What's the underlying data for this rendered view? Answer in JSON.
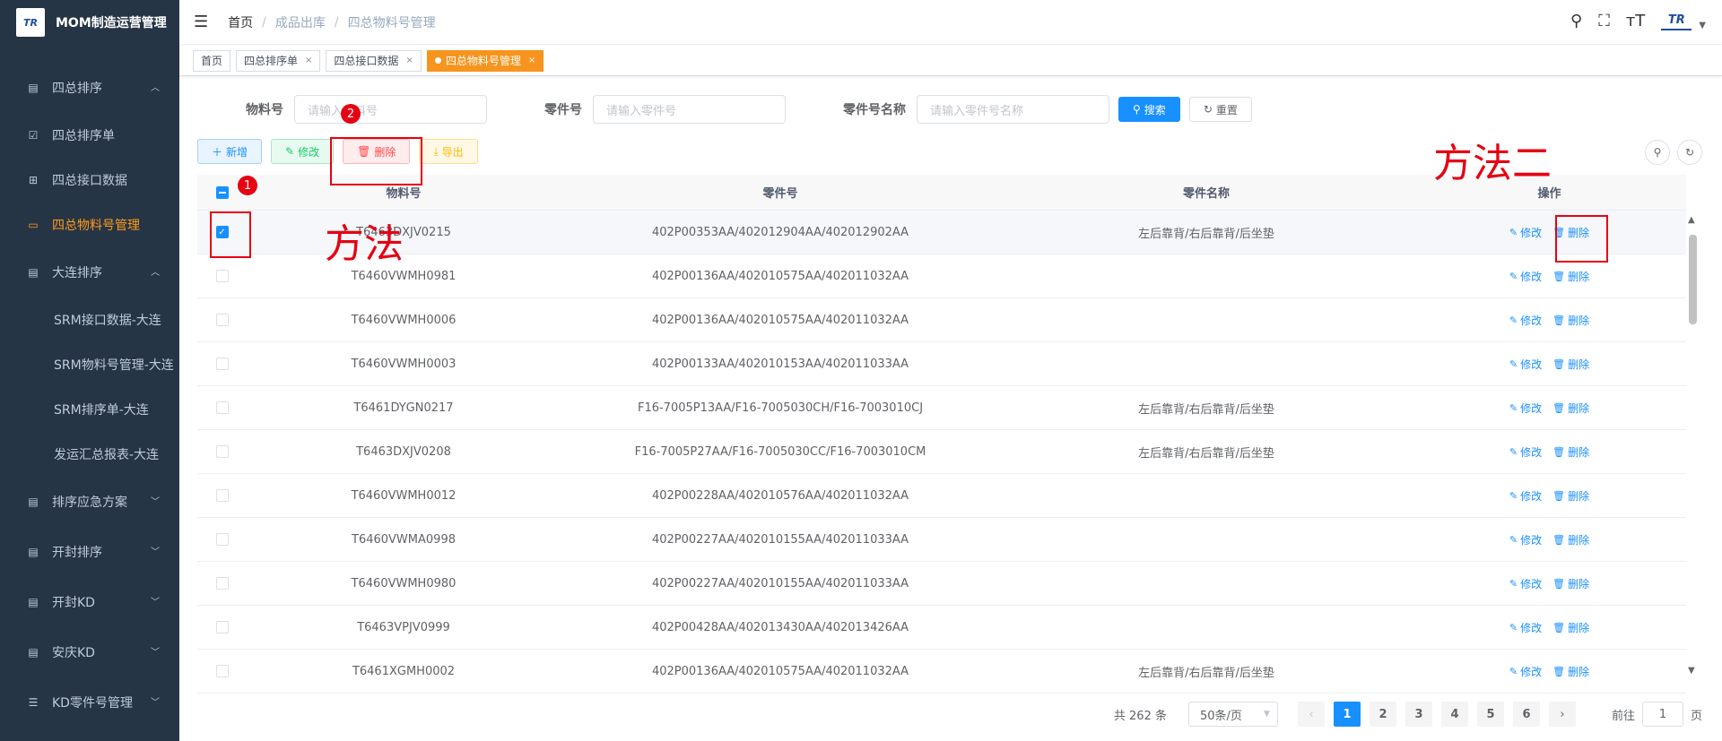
{
  "app": {
    "title": "MOM制造运营管理",
    "logo_text": "TR"
  },
  "sidebar": {
    "items": [
      {
        "label": "四总排序",
        "icon": "list-icon",
        "arrow": "︿"
      },
      {
        "label": "四总排序单",
        "icon": "checkbox-icon"
      },
      {
        "label": "四总接口数据",
        "icon": "table-icon"
      },
      {
        "label": "四总物料号管理",
        "icon": "box-icon"
      },
      {
        "label": "大连排序",
        "icon": "list-icon",
        "arrow": "︿"
      },
      {
        "label": "SRM接口数据-大连"
      },
      {
        "label": "SRM物料号管理-大连"
      },
      {
        "label": "SRM排序单-大连"
      },
      {
        "label": "发运汇总报表-大连"
      },
      {
        "label": "排序应急方案",
        "icon": "list-icon",
        "arrow": "﹀"
      },
      {
        "label": "开封排序",
        "icon": "list-icon",
        "arrow": "﹀"
      },
      {
        "label": "开封KD",
        "icon": "list-icon",
        "arrow": "﹀"
      },
      {
        "label": "安庆KD",
        "icon": "list-icon",
        "arrow": "﹀"
      },
      {
        "label": "KD零件号管理",
        "icon": "bullets-icon",
        "arrow": "﹀"
      }
    ]
  },
  "header": {
    "breadcrumb": [
      "首页",
      "成品出库",
      "四总物料号管理"
    ],
    "separator": "/"
  },
  "tags": [
    {
      "label": "首页",
      "closable": false
    },
    {
      "label": "四总排序单",
      "closable": true
    },
    {
      "label": "四总接口数据",
      "closable": true
    },
    {
      "label": "四总物料号管理",
      "closable": true,
      "active": true
    }
  ],
  "tag_close": "×",
  "search": {
    "material_label": "物料号",
    "material_placeholder": "请输入物料号",
    "part_label": "零件号",
    "part_placeholder": "请输入零件号",
    "part_name_label": "零件号名称",
    "part_name_placeholder": "请输入零件号名称",
    "search_btn": "搜索",
    "reset_btn": "重置"
  },
  "toolbar": {
    "add": "新增",
    "edit": "修改",
    "delete": "删除",
    "export": "导出"
  },
  "table": {
    "columns": [
      "物料号",
      "零件号",
      "零件名称",
      "操作"
    ],
    "edit_label": "修改",
    "delete_label": "删除",
    "rows": [
      {
        "mat": "T6463DXJV0215",
        "part": "402P00353AA/402012904AA/402012902AA",
        "name": "左后靠背/右后靠背/后坐垫",
        "checked": true
      },
      {
        "mat": "T6460VWMH0981",
        "part": "402P00136AA/402010575AA/402011032AA",
        "name": ""
      },
      {
        "mat": "T6460VWMH0006",
        "part": "402P00136AA/402010575AA/402011032AA",
        "name": ""
      },
      {
        "mat": "T6460VWMH0003",
        "part": "402P00133AA/402010153AA/402011033AA",
        "name": ""
      },
      {
        "mat": "T6461DYGN0217",
        "part": "F16-7005P13AA/F16-7005030CH/F16-7003010CJ",
        "name": "左后靠背/右后靠背/后坐垫"
      },
      {
        "mat": "T6463DXJV0208",
        "part": "F16-7005P27AA/F16-7005030CC/F16-7003010CM",
        "name": "左后靠背/右后靠背/后坐垫"
      },
      {
        "mat": "T6460VWMH0012",
        "part": "402P00228AA/402010576AA/402011032AA",
        "name": ""
      },
      {
        "mat": "T6460VWMA0998",
        "part": "402P00227AA/402010155AA/402011033AA",
        "name": ""
      },
      {
        "mat": "T6460VWMH0980",
        "part": "402P00227AA/402010155AA/402011033AA",
        "name": ""
      },
      {
        "mat": "T6463VPJV0999",
        "part": "402P00428AA/402013430AA/402013426AA",
        "name": ""
      },
      {
        "mat": "T6461XGMH0002",
        "part": "402P00136AA/402010575AA/402011032AA",
        "name": "左后靠背/右后靠背/后坐垫"
      }
    ]
  },
  "pagination": {
    "total": "共 262 条",
    "page_size": "50条/页",
    "pages": [
      "1",
      "2",
      "3",
      "4",
      "5",
      "6"
    ],
    "current": "1",
    "prev": "‹",
    "next": "›",
    "goto_label": "前往",
    "goto_value": "1",
    "page_suffix": "页"
  },
  "annotations": {
    "badge1": "1",
    "badge2": "2",
    "method1": "方法",
    "method2": "方法二"
  },
  "colors": {
    "sidebar_bg": "#263545",
    "active_orange": "#f7941d",
    "primary_blue": "#1890ff",
    "annotation_red": "#e60012"
  }
}
